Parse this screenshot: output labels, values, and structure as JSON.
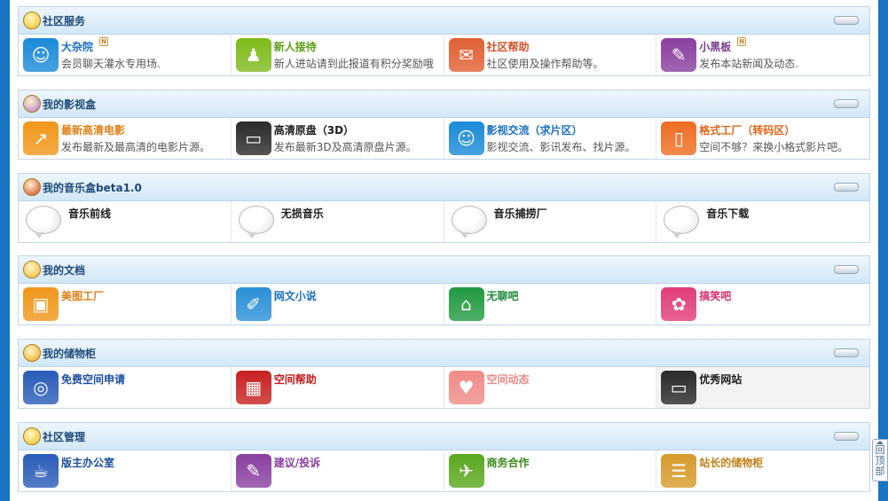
{
  "sections": [
    {
      "title": "社区服务",
      "icon": "leaf-icon",
      "icon_color": "#f3c21f",
      "items": [
        {
          "title": "大杂院",
          "desc": "会员聊天灌水专用场.",
          "title_color": "#1c6fc1",
          "icon": "people-icon",
          "icon_color": "#1a8ad8",
          "new_badge": "N"
        },
        {
          "title": "新人接待",
          "desc": "新人进站请到此报道有积分奖励哦",
          "title_color": "#5d9d17",
          "icon": "person-icon",
          "icon_color": "#7fba1a"
        },
        {
          "title": "社区帮助",
          "desc": "社区使用及操作帮助等。",
          "title_color": "#d2532a",
          "icon": "chat-bubbles-icon",
          "icon_color": "#e05f33"
        },
        {
          "title": "小黑板",
          "desc": "发布本站新闻及动态.",
          "title_color": "#7a3b8a",
          "icon": "pencil-icon",
          "icon_color": "#8a3fa0",
          "new_badge": "N"
        }
      ]
    },
    {
      "title": "我的影视盒",
      "icon": "balloon-icon",
      "icon_color": "#b16ed0",
      "items": [
        {
          "title": "最新高清电影",
          "desc": "发布最新及最高清的电影片源。",
          "title_color": "#e07f15",
          "icon": "chart-icon",
          "icon_color": "#f0961a"
        },
        {
          "title": "高清原盘（3D）",
          "desc": "发布最新3D及高清原盘片源。",
          "title_color": "#1c1c1c",
          "icon": "monitor-icon",
          "icon_color": "#2a2a2a"
        },
        {
          "title": "影视交流（求片区）",
          "desc": "影视交流、影讯发布、找片源。",
          "title_color": "#1c6fc1",
          "icon": "people-icon",
          "icon_color": "#1a8ad8"
        },
        {
          "title": "格式工厂（转码区）",
          "desc": "空间不够？来换小格式影片吧。",
          "title_color": "#e0661a",
          "icon": "phone-icon",
          "icon_color": "#ef6c22"
        }
      ]
    },
    {
      "title": "我的音乐盒beta1.0",
      "icon": "balloons-icon",
      "icon_color": "#d83a2a",
      "music": true,
      "items": [
        {
          "title": "音乐前线",
          "icon": "speech-bubble-icon"
        },
        {
          "title": "无损音乐",
          "icon": "speech-bubble-icon"
        },
        {
          "title": "音乐捕捞厂",
          "icon": "speech-bubble-icon"
        },
        {
          "title": "音乐下载",
          "icon": "speech-bubble-icon"
        }
      ]
    },
    {
      "title": "我的文档",
      "icon": "palette-icon",
      "icon_color": "#f4b830",
      "items": [
        {
          "title": "美图工厂",
          "title_color": "#e07f15",
          "icon": "picture-icon",
          "icon_color": "#f0961a"
        },
        {
          "title": "网文小说",
          "title_color": "#1c6fc1",
          "icon": "document-icon",
          "icon_color": "#2b8fd6"
        },
        {
          "title": "无聊吧",
          "title_color": "#1e8a3a",
          "icon": "home-icon",
          "icon_color": "#229a40"
        },
        {
          "title": "搞笑吧",
          "title_color": "#d83070",
          "icon": "paint-palette-icon",
          "icon_color": "#e23c78"
        }
      ]
    },
    {
      "title": "我的储物柜",
      "icon": "face-icon",
      "icon_color": "#f3a51f",
      "items": [
        {
          "title": "免费空间申请",
          "title_color": "#1c4fa0",
          "icon": "globe-icon",
          "icon_color": "#2a5cb8"
        },
        {
          "title": "空间帮助",
          "title_color": "#c21a1a",
          "icon": "web-icon",
          "icon_color": "#c92121"
        },
        {
          "title": "空间动态",
          "title_color": "#e98a86",
          "icon": "heart-icon",
          "icon_color": "#f08b88"
        },
        {
          "title": "优秀网站",
          "title_color": "#1c1c1c",
          "icon": "monitor-icon",
          "icon_color": "#2a2a2a",
          "shaded": true
        }
      ]
    },
    {
      "title": "社区管理",
      "icon": "smiley-icon",
      "icon_color": "#f3c21f",
      "items": [
        {
          "title": "版主办公室",
          "title_color": "#1c4fa0",
          "icon": "coffee-cup-icon",
          "icon_color": "#2a5cb8"
        },
        {
          "title": "建议/投诉",
          "title_color": "#8a3fa0",
          "icon": "pencil-icon",
          "icon_color": "#8a3fa0"
        },
        {
          "title": "商务合作",
          "title_color": "#3a8a1a",
          "icon": "bird-icon",
          "icon_color": "#5aa81e"
        },
        {
          "title": "站长的储物柜",
          "title_color": "#c0801a",
          "icon": "cabinet-icon",
          "icon_color": "#d79a2a"
        }
      ]
    }
  ],
  "back_to_top": {
    "label_lines": [
      "回",
      "顶",
      "部"
    ]
  }
}
